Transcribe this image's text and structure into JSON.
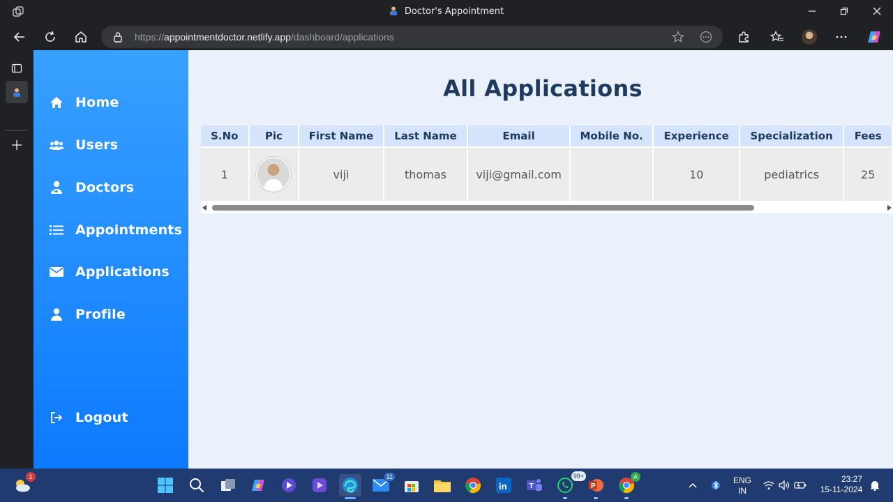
{
  "browser": {
    "window_title": "Doctor's Appointment",
    "url_prefix": "https://",
    "url_host": "appointmentdoctor.netlify.app",
    "url_path": "/dashboard/applications"
  },
  "sidebar": {
    "items": [
      {
        "label": "Home",
        "icon": "home-icon"
      },
      {
        "label": "Users",
        "icon": "users-icon"
      },
      {
        "label": "Doctors",
        "icon": "doctor-icon"
      },
      {
        "label": "Appointments",
        "icon": "list-icon"
      },
      {
        "label": "Applications",
        "icon": "envelope-icon"
      },
      {
        "label": "Profile",
        "icon": "user-icon"
      }
    ],
    "logout_label": "Logout"
  },
  "main": {
    "title": "All Applications",
    "table": {
      "headers": [
        "S.No",
        "Pic",
        "First Name",
        "Last Name",
        "Email",
        "Mobile No.",
        "Experience",
        "Specialization",
        "Fees"
      ],
      "rows": [
        {
          "sno": "1",
          "pic": "doctor-photo",
          "first_name": "viji",
          "last_name": "thomas",
          "email": "viji@gmail.com",
          "mobile": "",
          "experience": "10",
          "specialization": "pediatrics",
          "fees": "25"
        }
      ]
    }
  },
  "taskbar": {
    "weather_badge": "1",
    "mail_badge": "11",
    "whatsapp_badge": "99+",
    "chrome_badge": "A",
    "language": "ENG",
    "region": "IN",
    "time": "23:27",
    "date": "15-11-2024"
  },
  "colors": {
    "sidebar_top": "#38a0ff",
    "sidebar_bottom": "#0d7aff",
    "title": "#1f3a5f",
    "header_bg": "#d6e4fb",
    "main_bg": "#eaf1fb"
  }
}
